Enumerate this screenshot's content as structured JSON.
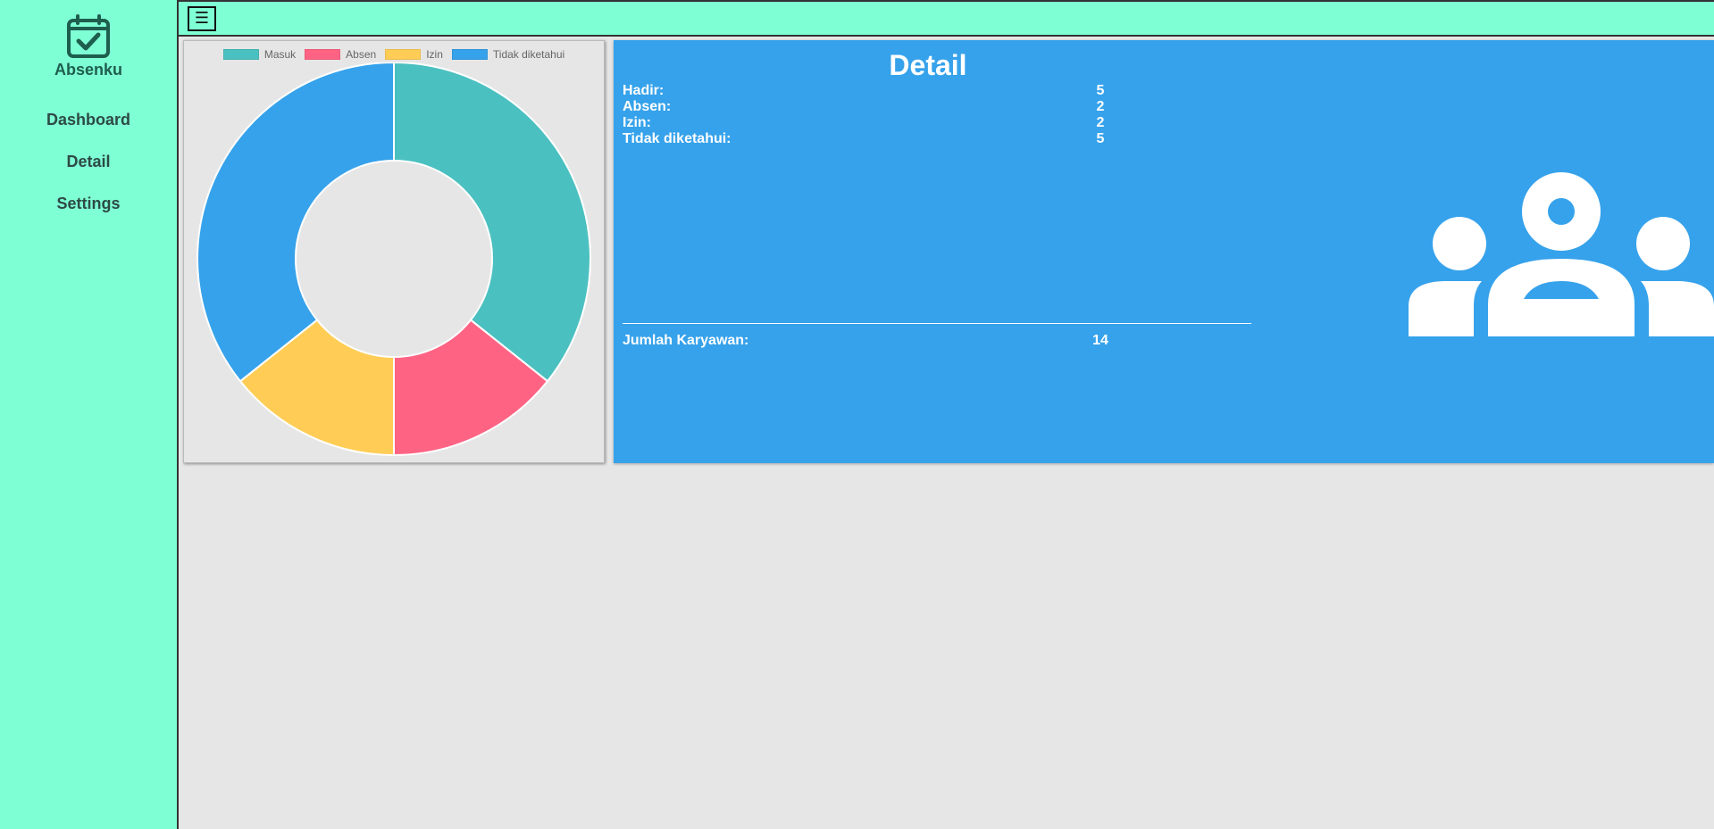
{
  "app": {
    "name": "Absenku"
  },
  "sidebar": {
    "items": [
      {
        "label": "Dashboard"
      },
      {
        "label": "Detail"
      },
      {
        "label": "Settings"
      }
    ]
  },
  "topbar": {
    "menu_icon": "☰"
  },
  "chart_data": {
    "type": "pie",
    "variant": "doughnut",
    "categories": [
      "Masuk",
      "Absen",
      "Izin",
      "Tidak diketahui"
    ],
    "values": [
      5,
      2,
      2,
      5
    ],
    "colors": [
      "#4bc0c0",
      "#ff6384",
      "#ffcd56",
      "#36a2eb"
    ],
    "legend_position": "top"
  },
  "detail": {
    "title": "Detail",
    "rows": [
      {
        "label": "Hadir:",
        "value": "5"
      },
      {
        "label": "Absen:",
        "value": "2"
      },
      {
        "label": "Izin:",
        "value": "2"
      },
      {
        "label": "Tidak diketahui:",
        "value": "5"
      }
    ],
    "total": {
      "label": "Jumlah Karyawan:",
      "value": "14"
    }
  },
  "colors": {
    "sidebar_bg": "#7fffd4",
    "detail_bg": "#36a2eb",
    "content_bg": "#e6e6e6",
    "brand_text": "#1e5e4d"
  }
}
